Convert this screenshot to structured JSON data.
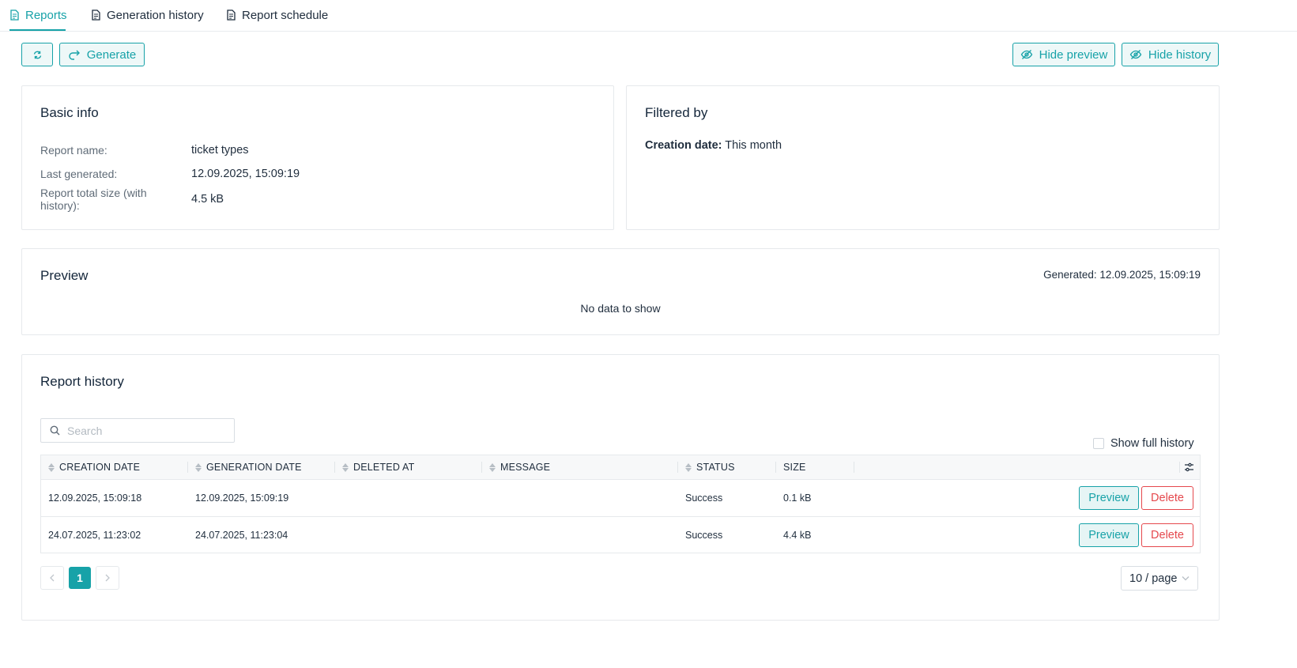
{
  "tabs": [
    {
      "label": "Reports",
      "active": true,
      "icon": "file-text-icon"
    },
    {
      "label": "Generation history",
      "active": false,
      "icon": "file-text-icon"
    },
    {
      "label": "Report schedule",
      "active": false,
      "icon": "file-text-icon"
    }
  ],
  "toolbar": {
    "refresh_icon": "refresh-icon",
    "generate_label": "Generate",
    "hide_preview_label": "Hide preview",
    "hide_history_label": "Hide history"
  },
  "basic_info": {
    "title": "Basic info",
    "report_name_label": "Report name:",
    "report_name_value": "ticket types",
    "last_generated_label": "Last generated:",
    "last_generated_value": "12.09.2025, 15:09:19",
    "total_size_label": "Report total size (with history):",
    "total_size_value": "4.5 kB"
  },
  "filtered_by": {
    "title": "Filtered by",
    "filter_key": "Creation date:",
    "filter_value": "This month"
  },
  "preview": {
    "title": "Preview",
    "generated": "Generated: 12.09.2025, 15:09:19",
    "empty_text": "No data to show"
  },
  "history": {
    "title": "Report history",
    "search_placeholder": "Search",
    "show_full_history_label": "Show full history",
    "show_full_history_checked": false,
    "columns": [
      "CREATION DATE",
      "GENERATION DATE",
      "DELETED AT",
      "MESSAGE",
      "STATUS",
      "SIZE"
    ],
    "rows": [
      {
        "creation_date": "12.09.2025, 15:09:18",
        "generation_date": "12.09.2025, 15:09:19",
        "deleted_at": "",
        "message": "",
        "status": "Success",
        "size": "0.1 kB"
      },
      {
        "creation_date": "24.07.2025, 11:23:02",
        "generation_date": "24.07.2025, 11:23:04",
        "deleted_at": "",
        "message": "",
        "status": "Success",
        "size": "4.4 kB"
      }
    ],
    "preview_label": "Preview",
    "delete_label": "Delete",
    "pagination": {
      "current_page": "1",
      "page_size": "10 / page"
    }
  },
  "colors": {
    "accent": "#17a2a8",
    "danger": "#e5484d"
  }
}
